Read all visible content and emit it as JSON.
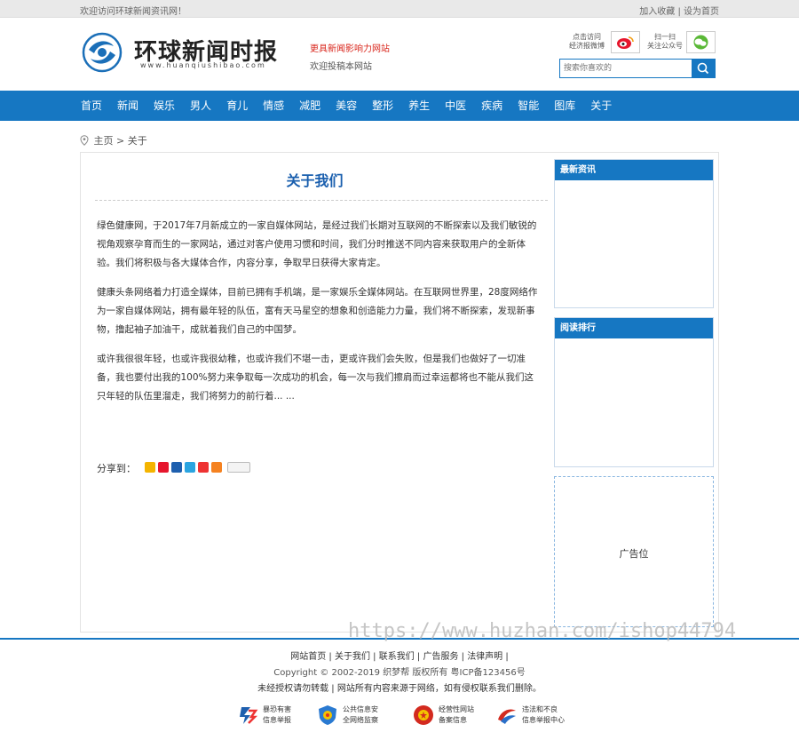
{
  "topbar": {
    "welcome": "欢迎访问环球新闻资讯网！",
    "add_favorite": "加入收藏",
    "separator": "|",
    "set_home": "设为首页"
  },
  "header": {
    "logo_text": "环球新闻时报",
    "logo_url": "www.huanqiushibao.com",
    "slogan": "更具新闻影响力网站",
    "contribute": "欢迎投稿本网站",
    "weibo_text_1": "点击访问",
    "weibo_text_2": "经济报微博",
    "wechat_text_1": "扫一扫",
    "wechat_text_2": "关注公众号",
    "search_placeholder": "搜索你喜欢的"
  },
  "nav": {
    "items": [
      "首页",
      "新闻",
      "娱乐",
      "男人",
      "育儿",
      "情感",
      "减肥",
      "美容",
      "整形",
      "养生",
      "中医",
      "疾病",
      "智能",
      "图库",
      "关于"
    ]
  },
  "breadcrumb": {
    "home": "主页",
    "sep": ">",
    "current": "关于"
  },
  "article": {
    "title": "关于我们",
    "paragraphs": [
      " 绿色健康网，于2017年7月新成立的一家自媒体网站，是经过我们长期对互联网的不断探索以及我们敏锐的视角观察孕育而生的一家网站，通过对客户使用习惯和时间，我们分时推送不同内容来获取用户的全新体验。我们将积极与各大媒体合作，内容分享，争取早日获得大家肯定。",
      "健康头条网络着力打造全媒体，目前已拥有手机端，是一家娱乐全媒体网站。在互联网世界里，28度网络作为一家自媒体网站，拥有最年轻的队伍，富有天马星空的想象和创造能力力量，我们将不断探索，发现新事物，撸起袖子加油干，成就着我们自己的中国梦。",
      "或许我很很年轻，也或许我很幼稚，也或许我们不堪一击，更或许我们会失败，但是我们也做好了一切准备，我也要付出我的100%努力来争取每一次成功的机会，每一次与我们擦肩而过幸运都将也不能从我们这只年轻的队伍里溜走，我们将努力的前行着... ..."
    ],
    "share_label": "分享到："
  },
  "sidebar": {
    "latest_title": "最新资讯",
    "ranking_title": "阅读排行",
    "ad_label": "广告位"
  },
  "footer": {
    "links": [
      "网站首页",
      "关于我们",
      "联系我们",
      "广告服务",
      "法律声明"
    ],
    "copyright": "Copyright © 2002-2019 织梦帮 版权所有 粤ICP备123456号",
    "note": "未经授权请勿转载 | 网站所有内容来源于网络，如有侵权联系我们删除。",
    "badges": [
      {
        "line1": "暴恐有害",
        "line2": "信息举报"
      },
      {
        "line1": "公共信息安",
        "line2": "全网络监察"
      },
      {
        "line1": "经营性网站",
        "line2": "备案信息"
      },
      {
        "line1": "违法和不良",
        "line2": "信息举报中心"
      }
    ]
  },
  "watermark": "https://www.huzhan.com/ishop44794",
  "colors": {
    "brand_blue": "#1677c2",
    "title_blue": "#1a5fae",
    "slogan_red": "#d9251b"
  }
}
